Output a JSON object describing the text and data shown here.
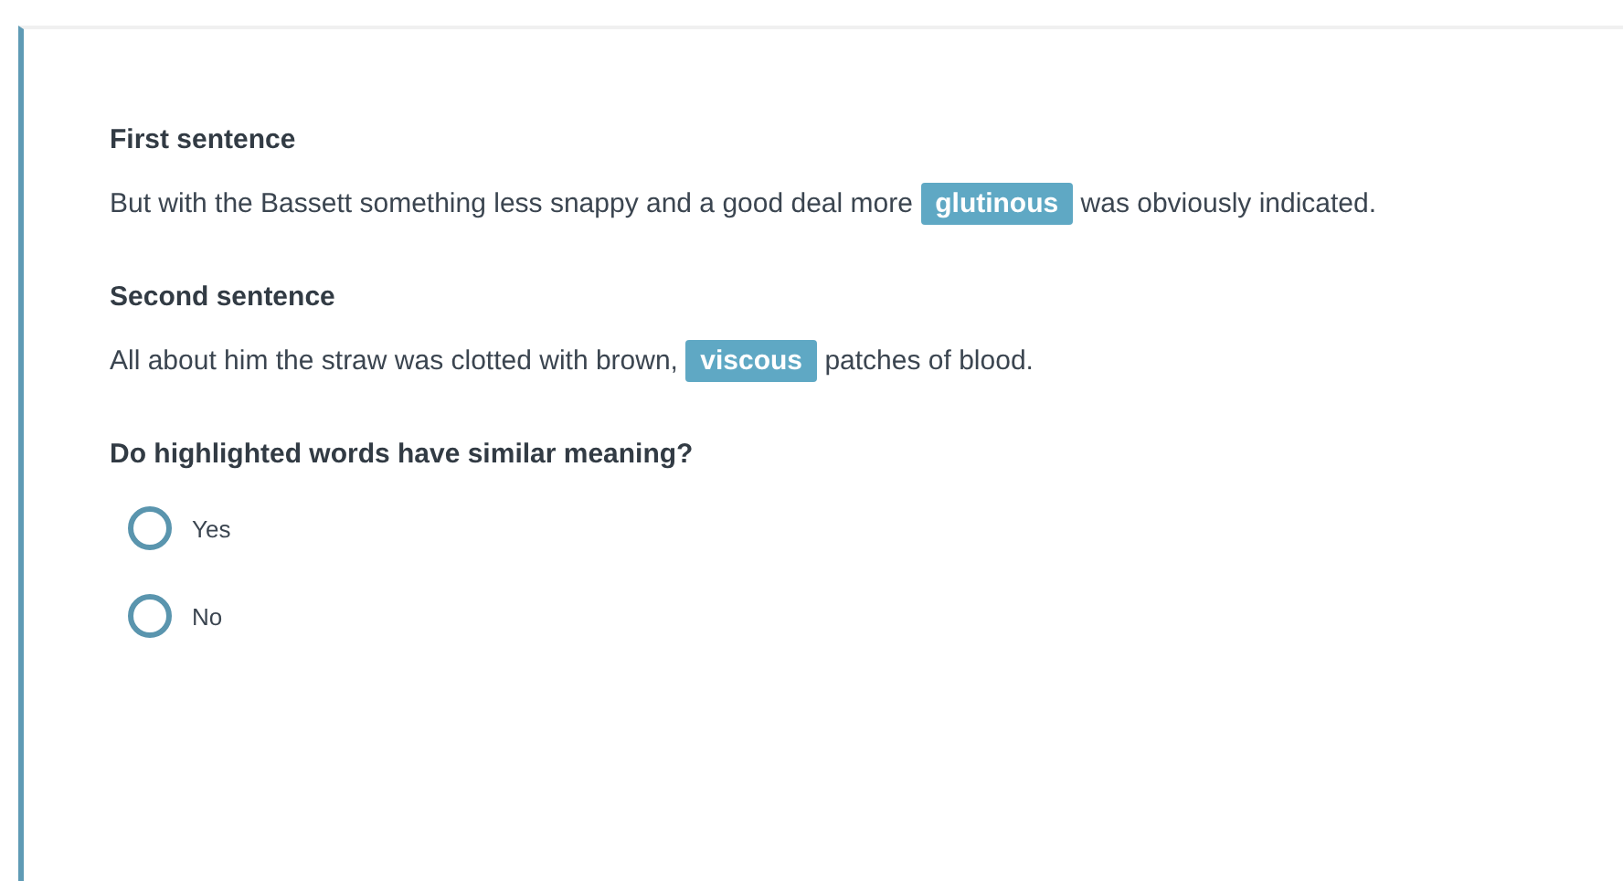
{
  "sentences": [
    {
      "title": "First sentence",
      "before": "But with the Bassett something less snappy and a good deal more",
      "highlight": "glutinous",
      "after": "was obviously indicated."
    },
    {
      "title": "Second sentence",
      "before": "All about him the straw was clotted with brown,",
      "highlight": "viscous",
      "after": "patches of blood."
    }
  ],
  "question": "Do highlighted words have similar meaning?",
  "options": [
    {
      "label": "Yes",
      "selected": false
    },
    {
      "label": "No",
      "selected": false
    }
  ]
}
